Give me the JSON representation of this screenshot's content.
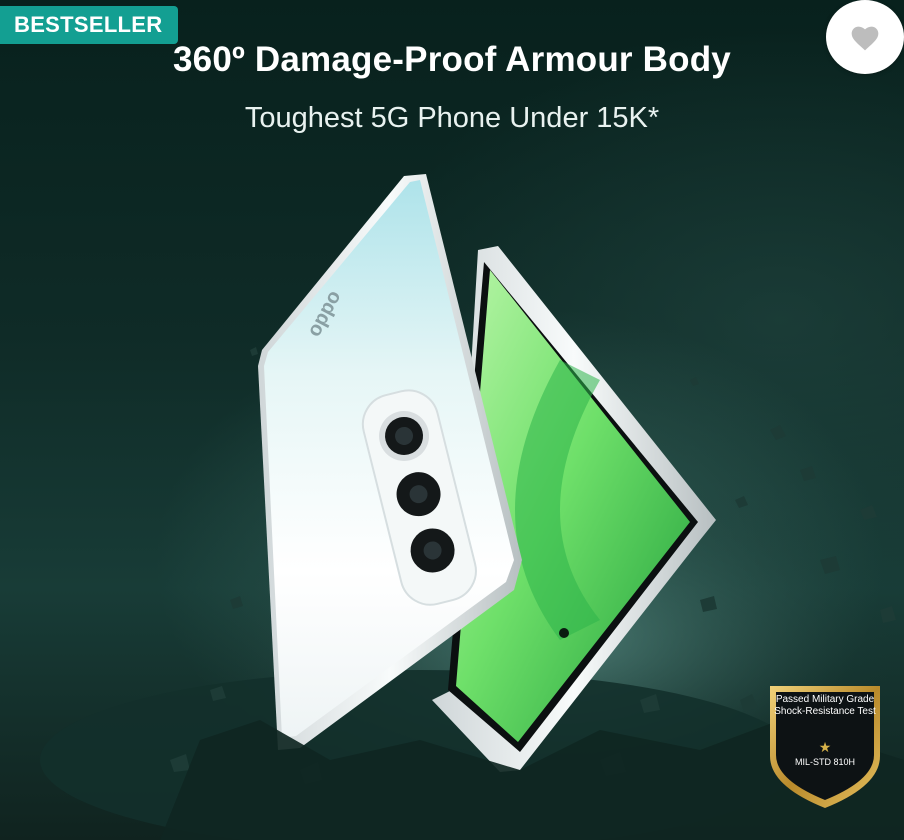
{
  "badge": {
    "label": "BESTSELLER"
  },
  "wishlist": {
    "icon": "heart-icon"
  },
  "banner": {
    "headline": "360º Damage-Proof Armour Body",
    "subhead": "Toughest 5G Phone Under 15K*",
    "phone_brand": "oppo"
  },
  "certification": {
    "text": "Passed Military Grade Shock-Resistance Test",
    "standard": "MIL-STD 810H"
  },
  "colors": {
    "badge": "#139f92",
    "background": "#0f2b27",
    "screen_green": "#6fe06a",
    "shield_gold": "#d7b24a"
  }
}
